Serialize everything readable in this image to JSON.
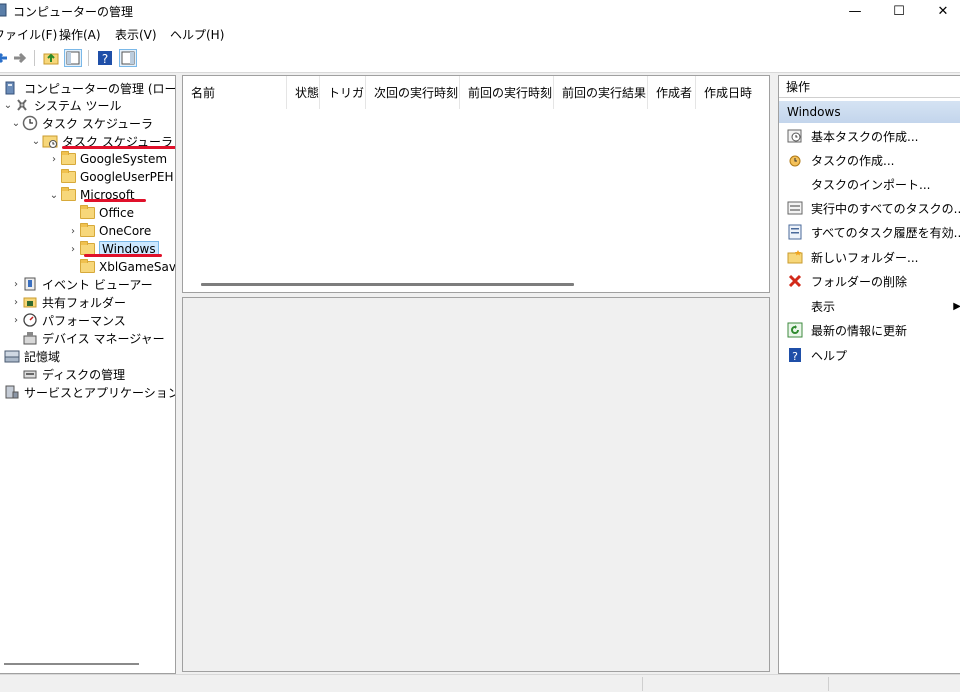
{
  "window": {
    "title": "コンピューターの管理",
    "minimize": "—",
    "maximize": "☐",
    "close": "✕"
  },
  "menu": [
    "ファイル(F)",
    "操作(A)",
    "表示(V)",
    "ヘルプ(H)"
  ],
  "tree": {
    "items": [
      {
        "label": "コンピューターの管理 (ローカル)",
        "icon": "computer-management-icon",
        "expanded": true
      },
      {
        "label": "システム ツール",
        "icon": "system-tools-icon",
        "expanded": true
      },
      {
        "label": "タスク スケジューラ",
        "icon": "clock-icon",
        "expanded": true
      },
      {
        "label": "タスク スケジューラ ライブラリ",
        "icon": "folder-clock-icon",
        "expanded": true
      },
      {
        "label": "GoogleSystem",
        "icon": "folder-icon",
        "expanded": false
      },
      {
        "label": "GoogleUserPEH",
        "icon": "folder-icon"
      },
      {
        "label": "Microsoft",
        "icon": "folder-icon",
        "expanded": true
      },
      {
        "label": "Office",
        "icon": "folder-icon"
      },
      {
        "label": "OneCore",
        "icon": "folder-icon",
        "expanded": false
      },
      {
        "label": "Windows",
        "icon": "folder-icon",
        "expanded": false,
        "selected": true
      },
      {
        "label": "XblGameSave",
        "icon": "folder-icon"
      },
      {
        "label": "イベント ビューアー",
        "icon": "event-viewer-icon",
        "expanded": false
      },
      {
        "label": "共有フォルダー",
        "icon": "shared-folders-icon",
        "expanded": false
      },
      {
        "label": "パフォーマンス",
        "icon": "performance-icon",
        "expanded": false
      },
      {
        "label": "デバイス マネージャー",
        "icon": "device-manager-icon"
      },
      {
        "label": "記憶域",
        "icon": "storage-icon",
        "expanded": true
      },
      {
        "label": "ディスクの管理",
        "icon": "disk-management-icon"
      },
      {
        "label": "サービスとアプリケーション",
        "icon": "services-apps-icon"
      }
    ]
  },
  "list": {
    "columns": [
      "名前",
      "状態",
      "トリガー",
      "次回の実行時刻",
      "前回の実行時刻",
      "前回の実行結果",
      "作成者",
      "作成日時"
    ],
    "rows": []
  },
  "actions": {
    "header": "操作",
    "section": "Windows",
    "items": [
      {
        "label": "基本タスクの作成...",
        "icon": "basic-task-icon"
      },
      {
        "label": "タスクの作成...",
        "icon": "create-task-icon"
      },
      {
        "label": "タスクのインポート...",
        "icon": ""
      },
      {
        "label": "実行中のすべてのタスクの...",
        "icon": "running-tasks-icon"
      },
      {
        "label": "すべてのタスク履歴を有効...",
        "icon": "task-history-icon"
      },
      {
        "label": "新しいフォルダー...",
        "icon": "new-folder-icon"
      },
      {
        "label": "フォルダーの削除",
        "icon": "delete-icon"
      },
      {
        "label": "表示",
        "icon": "",
        "submenu": true
      },
      {
        "label": "最新の情報に更新",
        "icon": "refresh-icon"
      },
      {
        "label": "ヘルプ",
        "icon": "help-icon"
      }
    ]
  },
  "colors": {
    "annotation": "#e0102a",
    "selection": "#cce8ff",
    "section_header": "#c3d5ec"
  }
}
